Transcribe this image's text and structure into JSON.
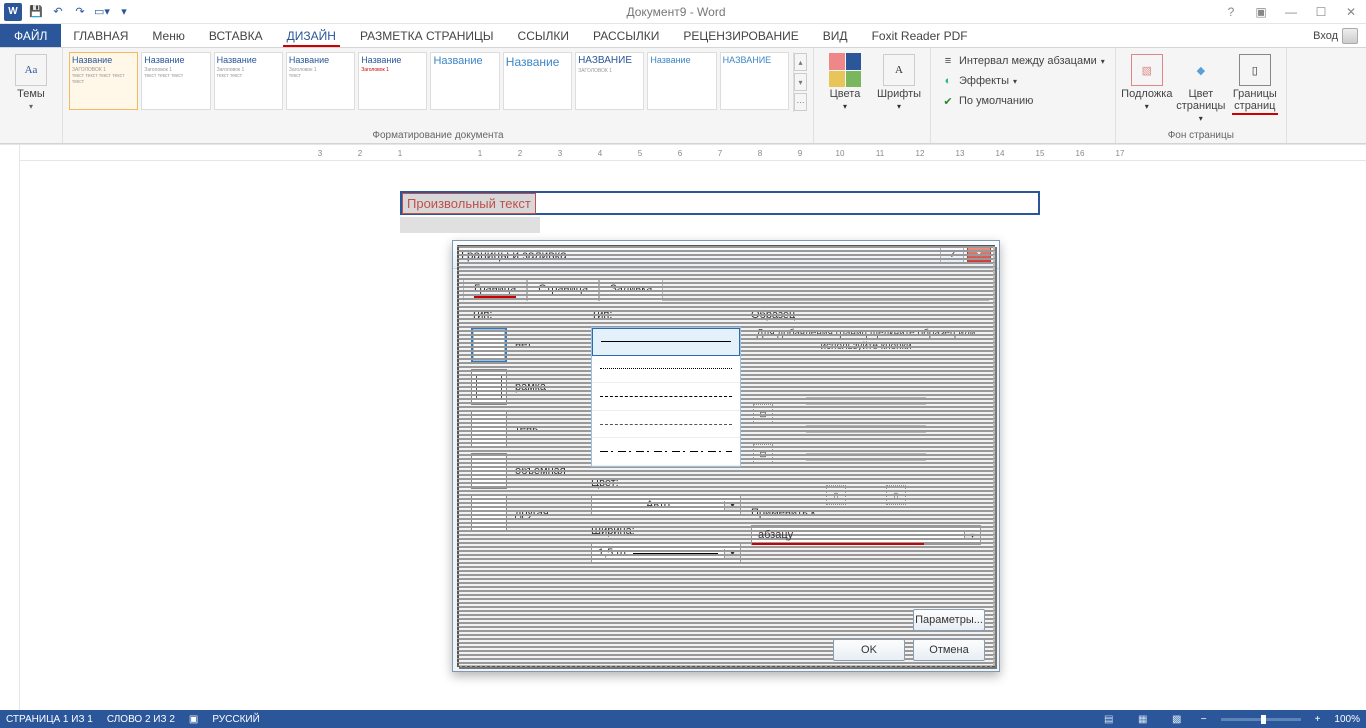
{
  "app": {
    "title": "Документ9 - Word",
    "signin": "Вход"
  },
  "tabs": {
    "file": "ФАЙЛ",
    "items": [
      "ГЛАВНАЯ",
      "Меню",
      "ВСТАВКА",
      "ДИЗАЙН",
      "РАЗМЕТКА СТРАНИЦЫ",
      "ССЫЛКИ",
      "РАССЫЛКИ",
      "РЕЦЕНЗИРОВАНИЕ",
      "ВИД",
      "Foxit Reader PDF"
    ],
    "active_index": 3
  },
  "ribbon": {
    "themes": "Темы",
    "formatting_label": "Форматирование документа",
    "colors": "Цвета",
    "fonts": "Шрифты",
    "spacing": "Интервал между абзацами",
    "effects": "Эффекты",
    "default": "По умолчанию",
    "watermark": "Подложка",
    "page_color": "Цвет страницы",
    "page_borders": "Границы страниц",
    "page_bg_label": "Фон страницы",
    "style_titles": [
      "Название",
      "Название",
      "Название",
      "Название",
      "Название",
      "Название",
      "Название",
      "НАЗВАНИЕ",
      "Название",
      "НАЗВАНИЕ"
    ]
  },
  "document": {
    "sample_text": "Произвольный текст",
    "ruler_marks": [
      "3",
      "2",
      "1",
      "",
      "1",
      "2",
      "3",
      "4",
      "5",
      "6",
      "7",
      "8",
      "9",
      "10",
      "11",
      "12",
      "13",
      "14",
      "15",
      "16",
      "17"
    ]
  },
  "dialog": {
    "title": "Границы и заливка",
    "tabs": [
      "Граница",
      "Страница",
      "Заливка"
    ],
    "active_tab": 0,
    "type_label": "Тип:",
    "type_opts": [
      "нет",
      "рамка",
      "тень",
      "объемная",
      "другая"
    ],
    "line_type_label": "Тип:",
    "color_label": "Цвет:",
    "color_value": "Авто",
    "width_label": "Ширина:",
    "width_value": "1,5 пт",
    "preview_label": "Образец",
    "preview_hint": "Для добавления границ щелкните образец или используйте кнопки",
    "apply_label": "Применить к:",
    "apply_value": "абзацу",
    "params": "Параметры...",
    "ok": "OK",
    "cancel": "Отмена"
  },
  "status": {
    "page": "СТРАНИЦА 1 ИЗ 1",
    "words": "СЛОВО 2 ИЗ 2",
    "lang": "РУССКИЙ",
    "zoom": "100%"
  }
}
